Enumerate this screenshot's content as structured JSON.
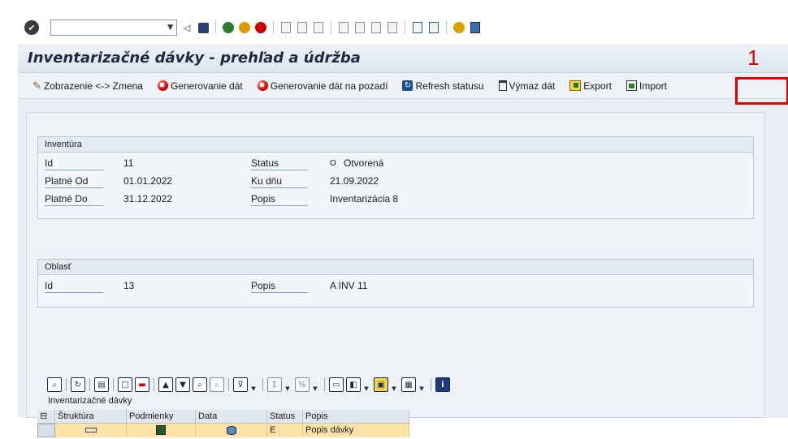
{
  "system_toolbar": {
    "icons": [
      "check-icon",
      "back-icon",
      "save-icon",
      "nav-back-icon",
      "exit-icon",
      "cancel-icon",
      "print-icon",
      "find-icon",
      "find-next-icon",
      "first-page-icon",
      "prev-page-icon",
      "next-page-icon",
      "last-page-icon",
      "new-session-icon",
      "shortcut-icon",
      "help-icon",
      "layout-icon"
    ]
  },
  "title": "Inventarizačné dávky - prehľad a údržba",
  "marker": "1",
  "app_toolbar": {
    "toggle": "Zobrazenie <-> Zmena",
    "generate": "Generovanie dát",
    "generate_bg": "Generovanie dát na pozadí",
    "refresh": "Refresh statusu",
    "delete": "Výmaz dát",
    "export": "Export",
    "import": "Import"
  },
  "inventura": {
    "title": "Inventúra",
    "id_label": "Id",
    "id_value": "11",
    "od_label": "Platné Od",
    "od_value": "01.01.2022",
    "do_label": "Platné Do",
    "do_value": "31.12.2022",
    "status_label": "Status",
    "status_code": "O",
    "status_value": "Otvorená",
    "kudnu_label": "Ku dňu",
    "kudnu_value": "21.09.2022",
    "popis_label": "Popis",
    "popis_value": "Inventarizácia 8"
  },
  "oblast": {
    "title": "Oblasť",
    "id_label": "Id",
    "id_value": "13",
    "popis_label": "Popis",
    "popis_value": "A INV 11"
  },
  "alv": {
    "title": "Inventarizačné dávky",
    "columns": [
      "Štruktúra",
      "Podmienky",
      "Data",
      "Status",
      "Popis"
    ],
    "rows": [
      {
        "status": "E",
        "popis": "Popis dávky"
      }
    ]
  },
  "colors": {
    "highlight": "#e00000",
    "row_bg": "#fde3a7",
    "title_text": "#1c2a40"
  }
}
